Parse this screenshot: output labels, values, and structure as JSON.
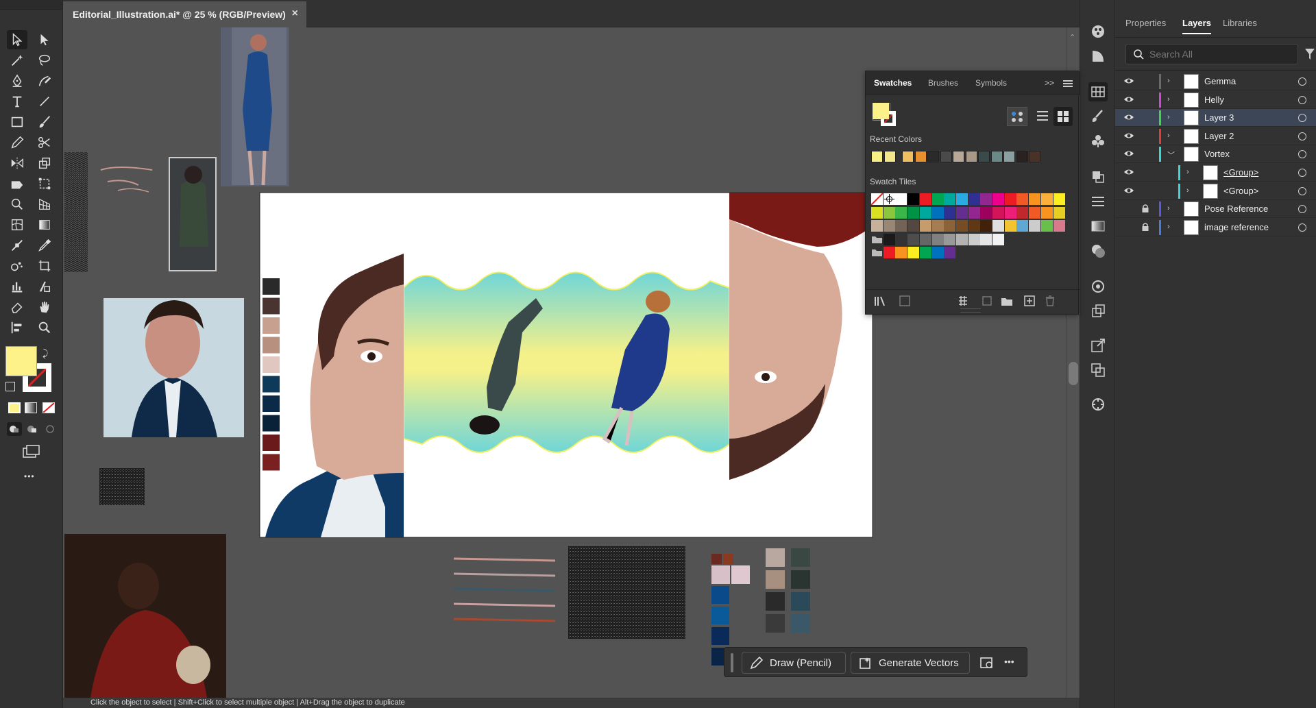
{
  "document": {
    "tab_title": "Editorial_Illustration.ai* @ 25 % (RGB/Preview)",
    "close_glyph": "×"
  },
  "status_bar": {
    "text": "Click the object to select  |  Shift+Click to select multiple object  |  Alt+Drag the object to duplicate"
  },
  "right_panel": {
    "tabs": [
      "Properties",
      "Layers",
      "Libraries"
    ],
    "active_tab": "Layers",
    "search_placeholder": "Search All",
    "layers": [
      {
        "name": "Gemma",
        "color": "#6b6b6b",
        "expanded": false,
        "locked": false,
        "visible": true,
        "indent": 0,
        "selected": false
      },
      {
        "name": "Helly",
        "color": "#d048d8",
        "expanded": false,
        "locked": false,
        "visible": true,
        "indent": 0,
        "selected": false
      },
      {
        "name": "Layer 3",
        "color": "#3ad84a",
        "expanded": false,
        "locked": false,
        "visible": true,
        "indent": 0,
        "selected": true
      },
      {
        "name": "Layer 2",
        "color": "#e03c3c",
        "expanded": false,
        "locked": false,
        "visible": true,
        "indent": 0,
        "selected": false
      },
      {
        "name": "Vortex",
        "color": "#3ad8d8",
        "expanded": true,
        "locked": false,
        "visible": true,
        "indent": 0,
        "selected": false
      },
      {
        "name": "<Group>",
        "color": "#3ad8d8",
        "expanded": false,
        "locked": false,
        "visible": true,
        "indent": 1,
        "selected": false
      },
      {
        "name": "<Group>",
        "color": "#3ad8d8",
        "expanded": false,
        "locked": false,
        "visible": true,
        "indent": 1,
        "selected": false
      },
      {
        "name": "Pose Reference",
        "color": "#5a5adc",
        "expanded": false,
        "locked": true,
        "visible": false,
        "indent": 0,
        "selected": false
      },
      {
        "name": "image reference",
        "color": "#4a7adc",
        "expanded": false,
        "locked": true,
        "visible": false,
        "indent": 0,
        "selected": false
      }
    ]
  },
  "swatches_panel": {
    "tabs": [
      "Swatches",
      "Brushes",
      "Symbols"
    ],
    "active_tab": "Swatches",
    "more_glyph": ">>",
    "recent_label": "Recent Colors",
    "tiles_label": "Swatch Tiles",
    "fill_color": "#fdf28a",
    "recent_colors": [
      "#f7ee86",
      "#f2e58a",
      "#f0c060",
      "#e8902e",
      "#2a2a2a",
      "#4a4a4a",
      "#b8a898",
      "#a89888",
      "#3a4a4a",
      "#6a8a8a",
      "#8aa0a0",
      "#2a2220",
      "#4a3228"
    ],
    "tile_rows": [
      [
        "none",
        "reg",
        "#ffffff",
        "#000000",
        "#ed1c24",
        "#00a651",
        "#00a99d",
        "#29abe2",
        "#2e3192",
        "#92278f",
        "#ec008c",
        "#ed1c24",
        "#f15a24",
        "#f7931e",
        "#fbb03b",
        "#fcee21"
      ],
      [
        "#d9e021",
        "#8cc63f",
        "#39b54a",
        "#009245",
        "#00a99d",
        "#0071bc",
        "#2e3192",
        "#662d91",
        "#93278f",
        "#9e005d",
        "#d4145a",
        "#ed1e79",
        "#c1272d",
        "#f15a24",
        "#f7931e",
        "#e6cf23"
      ],
      [
        "#c7b299",
        "#998675",
        "#736357",
        "#534741",
        "#c69c6d",
        "#a67c52",
        "#8c6239",
        "#754c24",
        "#603813",
        "#42210b",
        "#e0e0e0",
        "#f4c430",
        "#5fa8d3",
        "#cccccc",
        "#6abf4b",
        "#d97a8a"
      ],
      [
        "folder",
        "#1a1a1a",
        "#333333",
        "#4d4d4d",
        "#666666",
        "#808080",
        "#999999",
        "#b3b3b3",
        "#cccccc",
        "#e6e6e6",
        "#f2f2f2"
      ],
      [
        "folder",
        "#ed1c24",
        "#f7931e",
        "#fcee21",
        "#00a651",
        "#0071bc",
        "#662d91"
      ]
    ]
  },
  "ai_bar": {
    "draw_label": "Draw (Pencil)",
    "generate_label": "Generate Vectors",
    "more_glyph": "•••"
  },
  "toolbar": {
    "fill_color": "#fdf28a",
    "more_glyph": "•••"
  },
  "palettes": {
    "artboard_strip": [
      "#2a2a2a",
      "#4a3432",
      "#c8a090",
      "#b89080",
      "#e0c8c0",
      "#0e3a5a",
      "#0a2a48",
      "#0a2238",
      "#6a1a1a",
      "#7a2020"
    ],
    "lower_left_pairs": [
      [
        "#6a2a20",
        "#8a3a20"
      ],
      [
        "#d8c0c8",
        "#e0c8d0"
      ],
      [
        "#0a4a8a",
        "#0a4a8a"
      ],
      [
        "#0a5a9a",
        "#0a5a9a"
      ],
      [
        "#0a2a5a",
        "#0a2a5a"
      ],
      [
        "#0a2448",
        "#0a2448"
      ]
    ],
    "lower_right_pairs": [
      [
        "#b8a8a0",
        "#3a4844"
      ],
      [
        "#a89080",
        "#2a3430"
      ],
      [
        "#2a2a2a",
        "#2a4a5a"
      ],
      [
        "#3a3a3a",
        "#3a5868"
      ]
    ]
  }
}
